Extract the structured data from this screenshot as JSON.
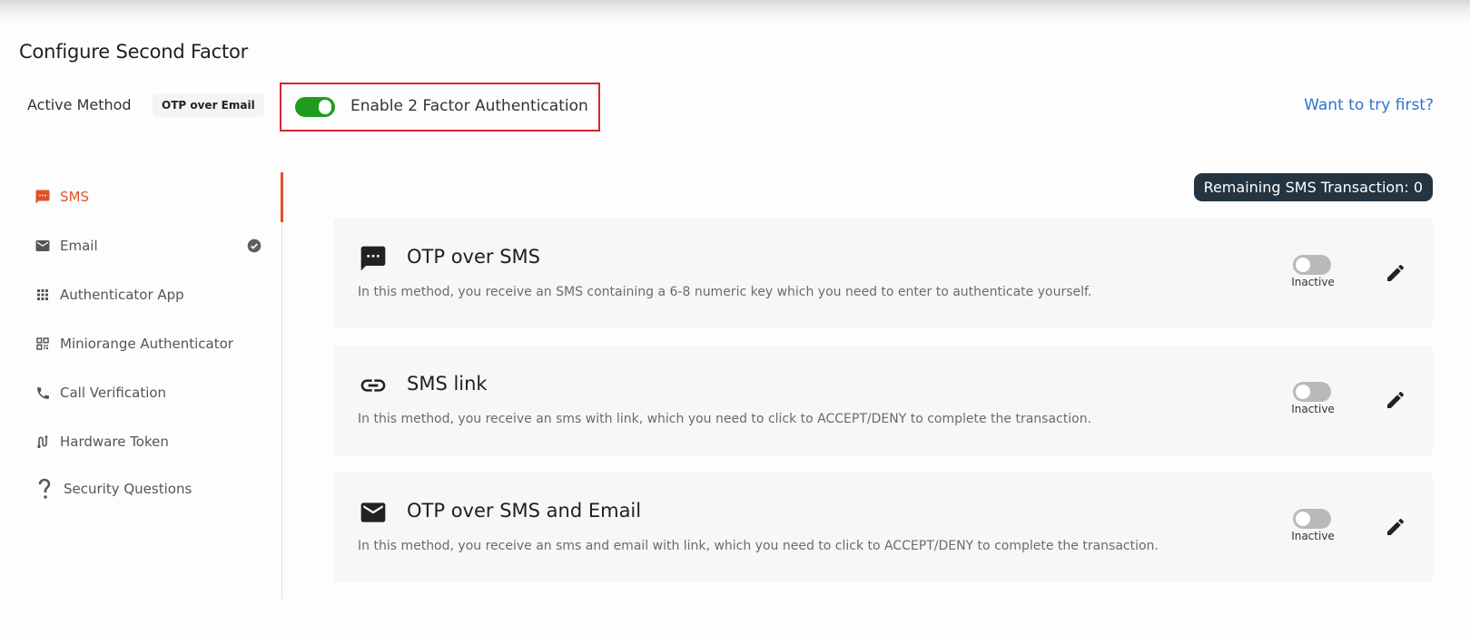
{
  "header": {
    "title": "Configure Second Factor",
    "active_method_label": "Active Method",
    "active_method_value": "OTP over Email",
    "enable_2fa_label": "Enable 2 Factor Authentication",
    "enable_2fa_on": true,
    "try_first_link": "Want to try first?"
  },
  "colors": {
    "accent": "#e0522b",
    "toggle_on": "#1e9c1e",
    "link": "#2f74d0",
    "highlight_border": "#d32630",
    "badge_dark": "#243441"
  },
  "sidebar": {
    "items": [
      {
        "label": "SMS",
        "icon": "sms-icon",
        "active": true
      },
      {
        "label": "Email",
        "icon": "email-icon",
        "configured": true
      },
      {
        "label": "Authenticator App",
        "icon": "grid-icon"
      },
      {
        "label": "Miniorange Authenticator",
        "icon": "qr-code-icon"
      },
      {
        "label": "Call Verification",
        "icon": "phone-icon"
      },
      {
        "label": "Hardware Token",
        "icon": "hardware-token-icon"
      },
      {
        "label": "Security Questions",
        "icon": "question-mark-icon"
      }
    ]
  },
  "main": {
    "remaining_sms": "Remaining SMS Transaction: 0",
    "methods": [
      {
        "title": "OTP over SMS",
        "icon": "sms-icon",
        "description": "In this method, you receive an SMS containing a 6-8 numeric key which you need to enter to authenticate yourself.",
        "status": "Inactive",
        "enabled": false
      },
      {
        "title": "SMS link",
        "icon": "link-icon",
        "description": "In this method, you receive an sms with link, which you need to click to ACCEPT/DENY to complete the transaction.",
        "status": "Inactive",
        "enabled": false
      },
      {
        "title": "OTP over SMS and Email",
        "icon": "email-icon",
        "description": "In this method, you receive an sms and email with link, which you need to click to ACCEPT/DENY to complete the transaction.",
        "status": "Inactive",
        "enabled": false
      }
    ]
  }
}
